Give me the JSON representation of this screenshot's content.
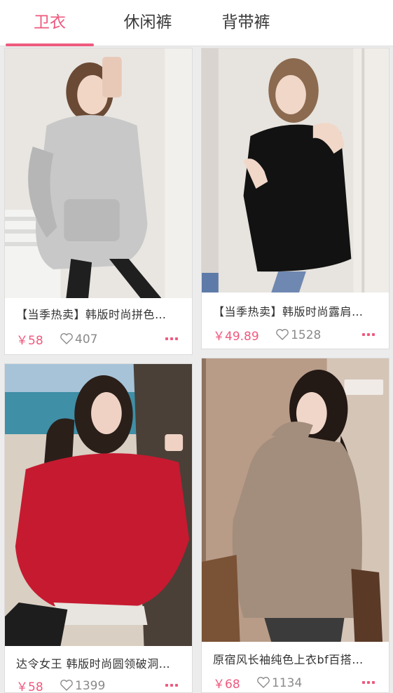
{
  "tabs": [
    {
      "label": "卫衣"
    },
    {
      "label": "休闲裤"
    },
    {
      "label": "背带裤"
    }
  ],
  "active_tab_index": 0,
  "colors": {
    "accent": "#ee5a7e",
    "price": "#ee5a7e",
    "muted": "#8a8a8a"
  },
  "products": [
    {
      "title": "【当季热卖】韩版时尚拼色…",
      "price": "￥58",
      "likes": "407"
    },
    {
      "title": "【当季热卖】韩版时尚露肩…",
      "price": "￥49.89",
      "likes": "1528"
    },
    {
      "title": "达令女王 韩版时尚圆领破洞…",
      "price": "￥58",
      "likes": "1399"
    },
    {
      "title": "原宿风长袖纯色上衣bf百搭…",
      "price": "￥68",
      "likes": "1134"
    }
  ]
}
